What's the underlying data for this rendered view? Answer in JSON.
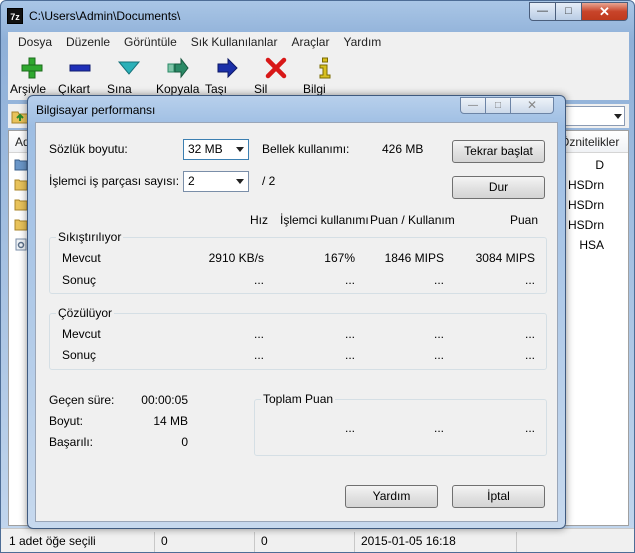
{
  "window": {
    "app_icon": "7z",
    "title": "C:\\Users\\Admin\\Documents\\",
    "controls": {
      "minimize": "—",
      "maximize": "□",
      "close": "✕"
    }
  },
  "menu": [
    "Dosya",
    "Düzenle",
    "Görüntüle",
    "Sık Kullanılanlar",
    "Araçlar",
    "Yardım"
  ],
  "toolbar": [
    {
      "label": "Arşivle",
      "icon": "plus-icon",
      "color": "#2fa82f"
    },
    {
      "label": "Çıkart",
      "icon": "minus-icon",
      "color": "#1f2fb8"
    },
    {
      "label": "Sına",
      "icon": "check-icon",
      "color": "#2ab0b8"
    },
    {
      "label": "Kopyala",
      "icon": "copy-arrow-icon",
      "color": "#2a8a66"
    },
    {
      "label": "Taşı",
      "icon": "move-arrow-icon",
      "color": "#1a2fa8"
    },
    {
      "label": "Sil",
      "icon": "delete-x-icon",
      "color": "#d81818"
    },
    {
      "label": "Bilgi",
      "icon": "info-icon",
      "color": "#d8c020"
    }
  ],
  "filelist": {
    "header_name": "Ad",
    "header_attrs": "Öznitelikler",
    "rows": [
      {
        "icon": "folder-blue-icon",
        "attr": "D"
      },
      {
        "icon": "folder-icon",
        "attr": "HSDrn"
      },
      {
        "icon": "folder-icon",
        "attr": "HSDrn"
      },
      {
        "icon": "folder-icon",
        "attr": "HSDrn"
      },
      {
        "icon": "settings-file-icon",
        "attr": "HSA"
      }
    ]
  },
  "status": {
    "selection": "1 adet öğe seçili",
    "size1": "0",
    "size2": "0",
    "date": "2015-01-05 16:18"
  },
  "dialog": {
    "title": "Bilgisayar performansı",
    "controls": {
      "minimize": "—",
      "maximize": "□",
      "close": "✕"
    },
    "dictionary_label": "Sözlük boyutu:",
    "dictionary_value": "32 MB",
    "memory_label": "Bellek kullanımı:",
    "memory_value": "426 MB",
    "threads_label": "İşlemci iş parçası sayısı:",
    "threads_value": "2",
    "threads_total": "/ 2",
    "restart_button": "Tekrar başlat",
    "stop_button": "Dur",
    "columns": {
      "speed": "Hız",
      "cpu": "İşlemci kullanımı",
      "rating_usage": "Puan / Kullanım",
      "rating": "Puan"
    },
    "compress": {
      "title": "Sıkıştırılıyor",
      "current": {
        "label": "Mevcut",
        "speed": "2910 KB/s",
        "cpu": "167%",
        "rating_usage": "1846 MIPS",
        "rating": "3084 MIPS"
      },
      "result": {
        "label": "Sonuç",
        "speed": "...",
        "cpu": "...",
        "rating_usage": "...",
        "rating": "..."
      }
    },
    "decompress": {
      "title": "Çözülüyor",
      "current": {
        "label": "Mevcut",
        "speed": "...",
        "cpu": "...",
        "rating_usage": "...",
        "rating": "..."
      },
      "result": {
        "label": "Sonuç",
        "speed": "...",
        "cpu": "...",
        "rating_usage": "...",
        "rating": "..."
      }
    },
    "elapsed_label": "Geçen süre:",
    "elapsed_value": "00:00:05",
    "size_label": "Boyut:",
    "size_value": "14 MB",
    "passes_label": "Başarılı:",
    "passes_value": "0",
    "total_rating": {
      "title": "Toplam Puan",
      "cpu": "...",
      "rating_usage": "...",
      "rating": "..."
    },
    "help_button": "Yardım",
    "cancel_button": "İptal"
  }
}
